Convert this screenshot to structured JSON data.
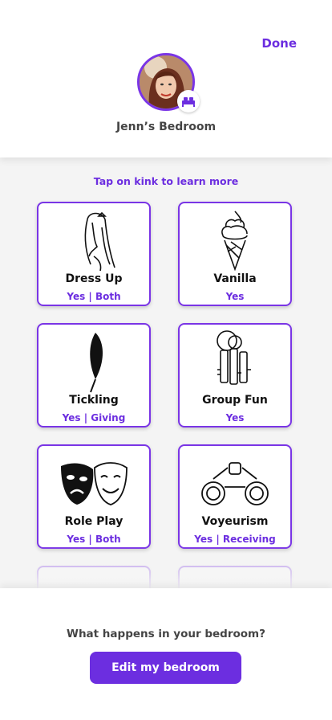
{
  "header": {
    "done_label": "Done",
    "room_name": "Jenn’s Bedroom"
  },
  "hint": "Tap on kink to learn more",
  "cards": [
    {
      "title": "Dress Up",
      "status": "Yes | Both",
      "icon": "woman-profile-icon"
    },
    {
      "title": "Vanilla",
      "status": "Yes",
      "icon": "ice-cream-cone-icon"
    },
    {
      "title": "Tickling",
      "status": "Yes | Giving",
      "icon": "feather-icon"
    },
    {
      "title": "Group Fun",
      "status": "Yes",
      "icon": "keys-icon"
    },
    {
      "title": "Role Play",
      "status": "Yes | Both",
      "icon": "theater-masks-icon"
    },
    {
      "title": "Voyeurism",
      "status": "Yes | Receiving",
      "icon": "binoculars-icon"
    }
  ],
  "footer": {
    "question": "What happens in your bedroom?",
    "edit_label": "Edit my bedroom"
  },
  "colors": {
    "accent": "#6c2ee0",
    "card_border": "#7a35e6"
  }
}
